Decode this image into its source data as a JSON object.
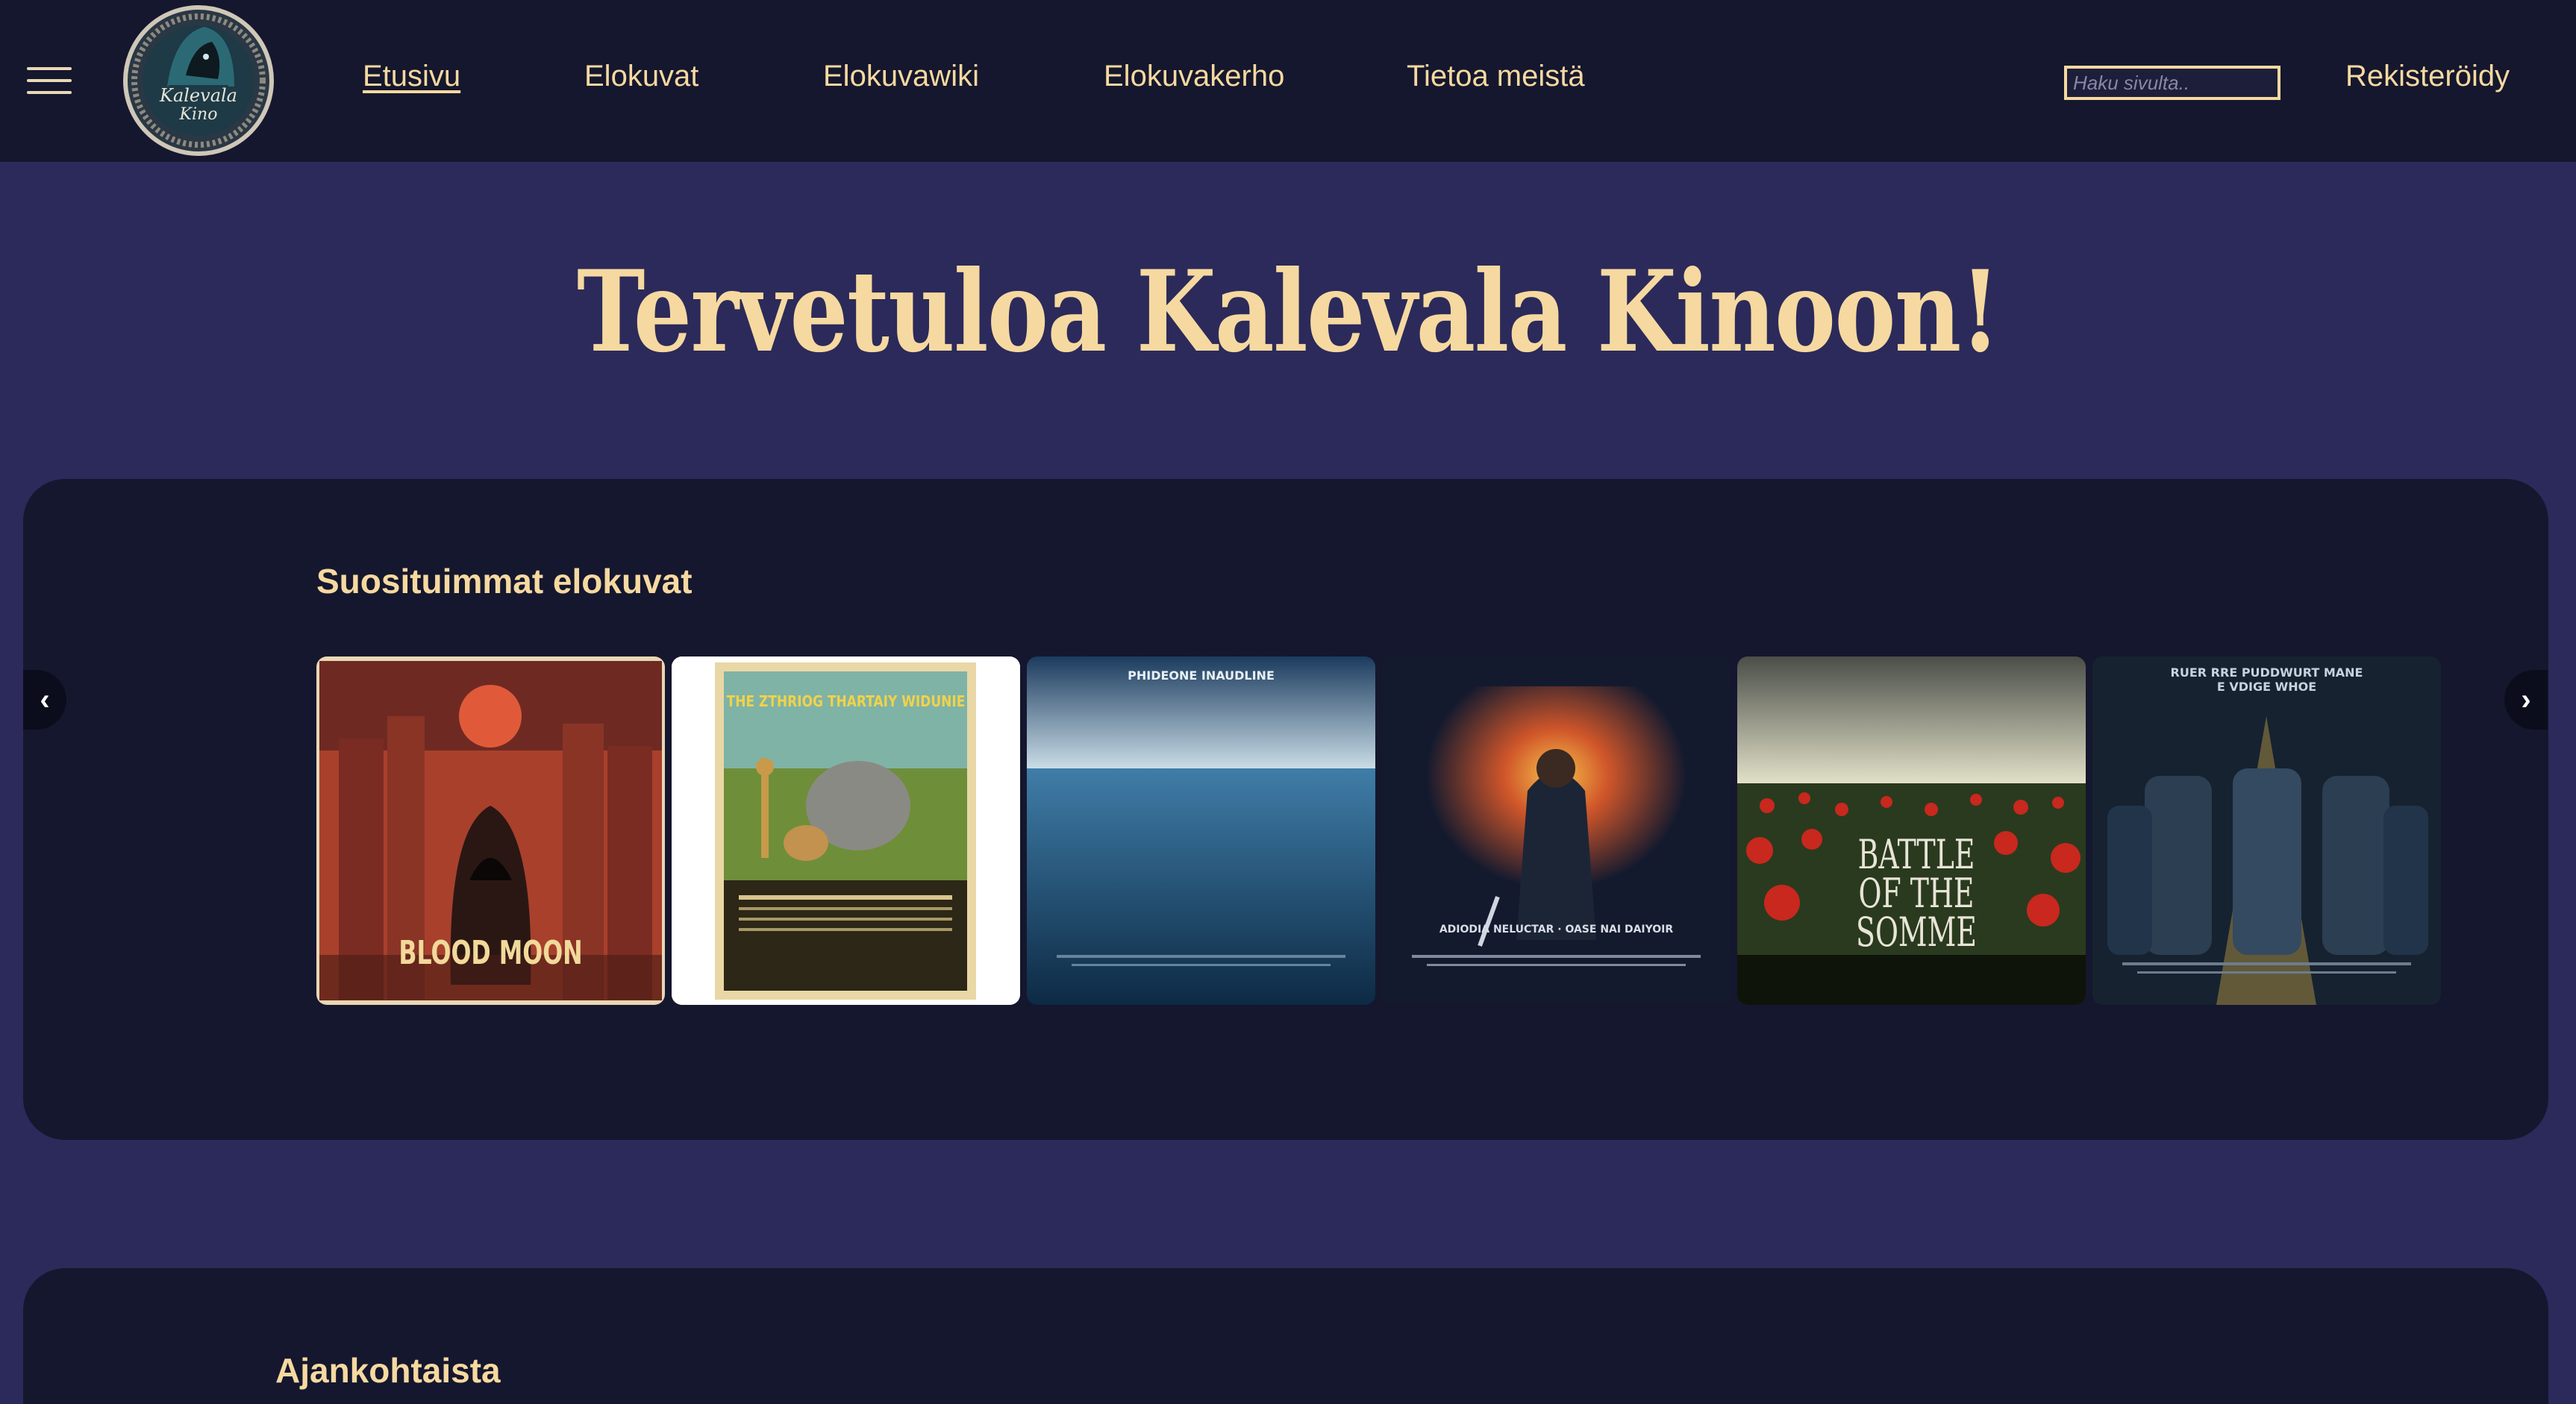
{
  "header": {
    "logo_alt": "Kalevala Kino",
    "logo_text_line1": "Kalevala",
    "logo_text_line2": "Kino",
    "nav": [
      {
        "label": "Etusivu",
        "active": true
      },
      {
        "label": "Elokuvat",
        "active": false
      },
      {
        "label": "Elokuvawiki",
        "active": false
      },
      {
        "label": "Elokuvakerho",
        "active": false
      },
      {
        "label": "Tietoa meistä",
        "active": false
      }
    ],
    "search_placeholder": "Haku sivulta..",
    "register_label": "Rekisteröidy"
  },
  "hero": {
    "title": "Tervetuloa Kalevala Kinoon!"
  },
  "popular": {
    "title": "Suosituimmat elokuvat",
    "prev_icon": "‹",
    "next_icon": "›",
    "posters": [
      {
        "title": "BLOOD MOON"
      },
      {
        "title": "THE ZTHRIOG THARTAIY WIDUNIE"
      },
      {
        "title": "PHIDEONE INAUDLINE"
      },
      {
        "title": "ADIODIA NELUCTAR · OASE NAI DAIYOIR"
      },
      {
        "title": "BATTLE OF THE SOMME"
      },
      {
        "title": "RUER RRE PUDDWURT MANE E VDIGE WHOE"
      }
    ]
  },
  "news": {
    "title": "Ajankohtaista"
  },
  "colors": {
    "page_bg": "#2b2a5a",
    "header_bg": "#15172e",
    "panel_bg": "#15172e",
    "accent": "#f6d9a0"
  }
}
